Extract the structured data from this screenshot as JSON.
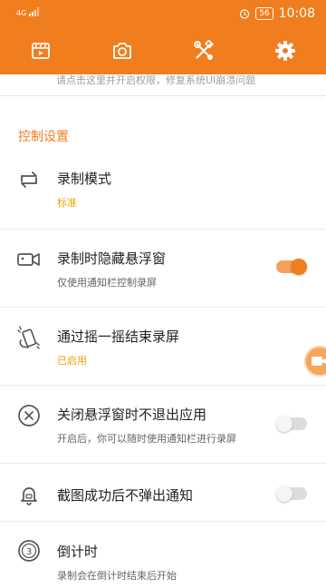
{
  "status_bar": {
    "signal_label": "4G",
    "battery": "56",
    "time": "10:08"
  },
  "toolbar": {
    "tabs": [
      {
        "icon": "video-list-icon"
      },
      {
        "icon": "camera-icon"
      },
      {
        "icon": "tools-icon"
      },
      {
        "icon": "settings-gear-icon"
      }
    ]
  },
  "notice": "请点击这里并开启权限，修复系统UI崩溃问题",
  "section": {
    "title": "控制设置",
    "settings": [
      {
        "title": "录制模式",
        "subtitle": "标准",
        "icon": "swap-arrows-icon"
      },
      {
        "title": "录制时隐藏悬浮窗",
        "subtitle": "仅使用通知栏控制录屏",
        "icon": "camera-outline-icon",
        "toggle": "on"
      },
      {
        "title": "通过摇一摇结束录屏",
        "subtitle": "已启用",
        "icon": "shake-hand-icon"
      },
      {
        "title": "关闭悬浮窗时不退出应用",
        "subtitle": "开启后，你可以随时使用通知栏进行录屏",
        "icon": "circle-x-icon",
        "toggle": "off"
      },
      {
        "title": "截图成功后不弹出通知",
        "subtitle": "",
        "icon": "bell-icon",
        "toggle": "off"
      },
      {
        "title": "倒计时",
        "subtitle": "录制会在倒计时结束后开始",
        "icon": "countdown-icon"
      }
    ]
  },
  "colors": {
    "accent": "#f07e1e",
    "accent_light": "#f6a15c",
    "subtitle_accent": "#f0a000"
  }
}
